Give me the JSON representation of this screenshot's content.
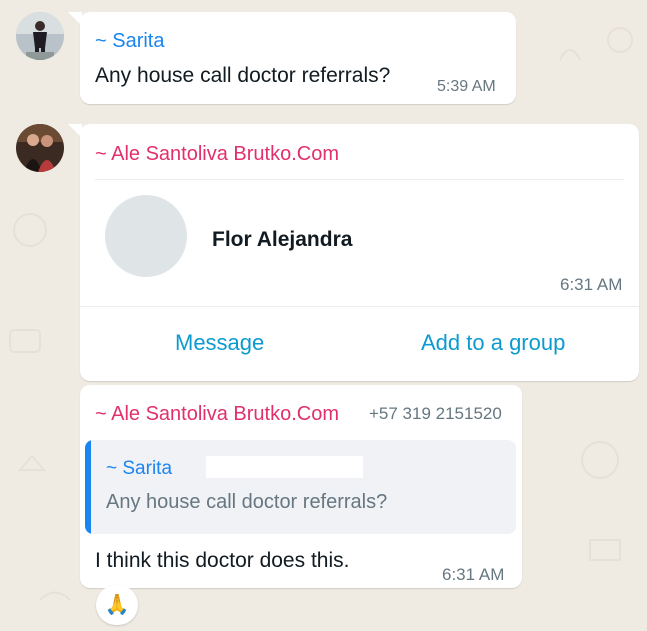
{
  "colors": {
    "background": "#efeae2",
    "bubble": "#ffffff",
    "sarita_name": "#1a85f0",
    "ale_name": "#e1306c",
    "action_link": "#0b9bd1",
    "quote_bar": "#1a85f0"
  },
  "messages": [
    {
      "sender": "~ Sarita",
      "text": "Any house call doctor referrals?",
      "time": "5:39 AM"
    },
    {
      "sender": "~ Ale Santoliva Brutko.Com",
      "contact_card": {
        "name": "Flor Alejandra",
        "time": "6:31 AM",
        "message_action": "Message",
        "add_group_action": "Add to a group"
      }
    },
    {
      "sender": "~ Ale Santoliva Brutko.Com",
      "phone": "+57 319 2151520",
      "quote": {
        "sender": "~ Sarita",
        "text": "Any house call doctor referrals?"
      },
      "text": "I think this doctor does this.",
      "time": "6:31 AM",
      "reaction": "🙏"
    }
  ]
}
